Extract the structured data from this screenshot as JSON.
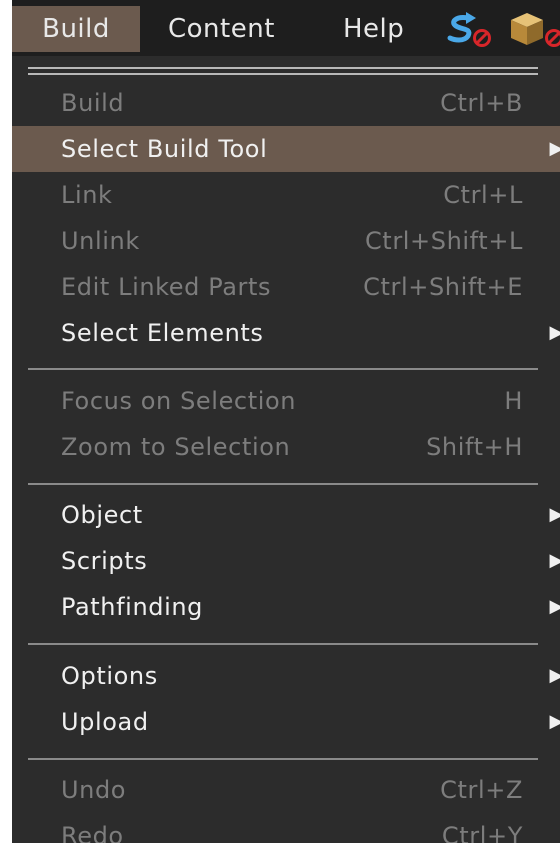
{
  "menubar": {
    "items": [
      "Build",
      "Content",
      "Help"
    ]
  },
  "colors": {
    "background": "#2c2c2c",
    "menubar": "#1e1e1e",
    "highlight": "#6b5a4e",
    "enabled_text": "#f0f0f0",
    "disabled_text": "#7d7d7d",
    "status_blue": "#4aa8e8",
    "status_red": "#d8262a"
  },
  "status_icons": [
    "pathfinding-status-icon",
    "no-build-icon",
    "object-box-icon",
    "no-object-icon"
  ],
  "menu": {
    "build": {
      "label": "Build",
      "shortcut": "Ctrl+B"
    },
    "select_build_tool": {
      "label": "Select Build Tool",
      "arrow": "▶"
    },
    "link": {
      "label": "Link",
      "shortcut": "Ctrl+L"
    },
    "unlink": {
      "label": "Unlink",
      "shortcut": "Ctrl+Shift+L"
    },
    "edit_linked_parts": {
      "label": "Edit Linked Parts",
      "shortcut": "Ctrl+Shift+E"
    },
    "select_elements": {
      "label": "Select Elements",
      "arrow": "▶"
    },
    "focus_on_selection": {
      "label": "Focus on Selection",
      "shortcut": "H"
    },
    "zoom_to_selection": {
      "label": "Zoom to Selection",
      "shortcut": "Shift+H"
    },
    "object": {
      "label": "Object",
      "arrow": "▶"
    },
    "scripts": {
      "label": "Scripts",
      "arrow": "▶"
    },
    "pathfinding": {
      "label": "Pathfinding",
      "arrow": "▶"
    },
    "options": {
      "label": "Options",
      "arrow": "▶"
    },
    "upload": {
      "label": "Upload",
      "arrow": "▶"
    },
    "undo": {
      "label": "Undo",
      "shortcut": "Ctrl+Z"
    },
    "redo": {
      "label": "Redo",
      "shortcut": "Ctrl+Y"
    }
  }
}
